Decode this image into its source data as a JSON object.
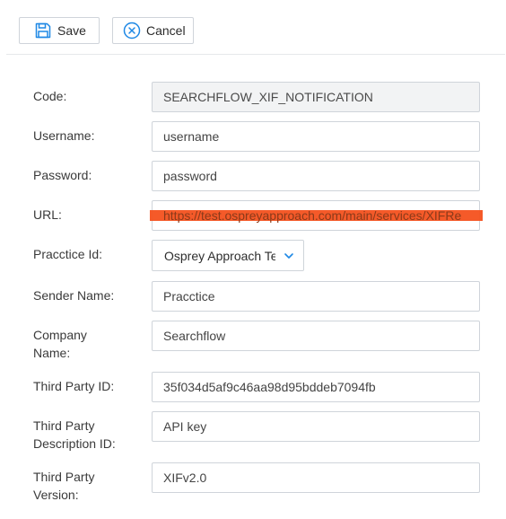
{
  "toolbar": {
    "save_label": "Save",
    "cancel_label": "Cancel",
    "save_icon": "floppy-disk-icon",
    "cancel_icon": "circle-x-icon"
  },
  "form": {
    "code": {
      "label": "Code:",
      "value": "SEARCHFLOW_XIF_NOTIFICATION"
    },
    "username": {
      "label": "Username:",
      "value": "username"
    },
    "password": {
      "label": "Password:",
      "value": "password"
    },
    "url": {
      "label": "URL:",
      "value": "https://test.ospreyapproach.com/main/services/XIFRe"
    },
    "practice_id": {
      "label": "Pracctice Id:",
      "selected": "Osprey Approach Te",
      "icon": "chevron-down-icon"
    },
    "sender_name": {
      "label": "Sender Name:",
      "value": "Pracctice"
    },
    "company_name": {
      "label_line1": "Company",
      "label_line2": "Name:",
      "value": "Searchflow"
    },
    "third_party_id": {
      "label": "Third Party ID:",
      "value": "35f034d5af9c46aa98d95bddeb7094fb"
    },
    "third_party_description_id": {
      "label_line1": "Third Party",
      "label_line2": "Description ID:",
      "value": "API key"
    },
    "third_party_version": {
      "label_line1": "Third Party",
      "label_line2": "Version:",
      "value": "XIFv2.0"
    }
  },
  "colors": {
    "highlight": "#f4511e",
    "border": "#cfd4da",
    "readonly_bg": "#f2f3f4",
    "icon_blue": "#1e88e5"
  }
}
